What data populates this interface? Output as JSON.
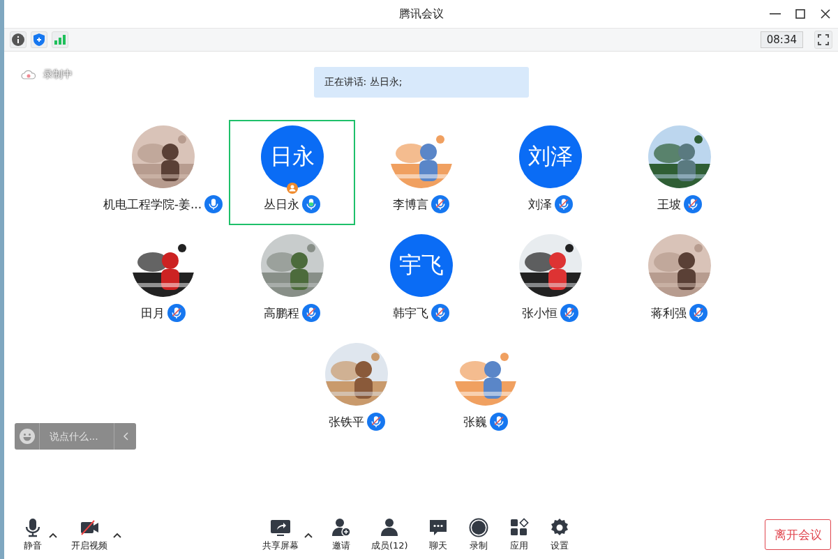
{
  "window": {
    "title": "腾讯会议"
  },
  "info_bar": {
    "time": "08:34"
  },
  "recording_indicator": {
    "label": "录制中"
  },
  "speaking_banner": {
    "text": "正在讲话: 丛日永;"
  },
  "participants": [
    {
      "name": "机电工程学院-姜...",
      "muted": false,
      "speaking": false,
      "host": false,
      "selected": false
    },
    {
      "name": "丛日永",
      "avatar": {
        "kind": "initials",
        "text": "日永"
      },
      "muted": false,
      "speaking": true,
      "host": true,
      "selected": true
    },
    {
      "name": "李博言",
      "muted": true,
      "speaking": false,
      "host": false,
      "selected": false
    },
    {
      "name": "刘泽",
      "avatar": {
        "kind": "initials",
        "text": "刘泽"
      },
      "muted": true,
      "speaking": false,
      "host": false,
      "selected": false
    },
    {
      "name": "王坡",
      "muted": true,
      "speaking": false,
      "host": false,
      "selected": false
    },
    {
      "name": "田月",
      "muted": true,
      "speaking": false,
      "host": false,
      "selected": false
    },
    {
      "name": "高鹏程",
      "muted": true,
      "speaking": false,
      "host": false,
      "selected": false
    },
    {
      "name": "韩宇飞",
      "avatar": {
        "kind": "initials",
        "text": "宇飞"
      },
      "muted": true,
      "speaking": false,
      "host": false,
      "selected": false
    },
    {
      "name": "张小恒",
      "muted": true,
      "speaking": false,
      "host": false,
      "selected": false
    },
    {
      "name": "蒋利强",
      "muted": true,
      "speaking": false,
      "host": false,
      "selected": false
    },
    {
      "name": "张铁平",
      "muted": true,
      "speaking": false,
      "host": false,
      "selected": false
    },
    {
      "name": "张巍",
      "muted": true,
      "speaking": false,
      "host": false,
      "selected": false
    }
  ],
  "chat_input": {
    "placeholder": "说点什么..."
  },
  "toolbar": {
    "left": [
      {
        "kind": "mute",
        "label": "静音",
        "caret": true
      },
      {
        "kind": "video",
        "label": "开启视频",
        "caret": true
      }
    ],
    "center": [
      {
        "kind": "share",
        "label": "共享屏幕",
        "caret": true
      },
      {
        "kind": "invite",
        "label": "邀请",
        "caret": false
      },
      {
        "kind": "members",
        "label": "成员(12)",
        "caret": false
      },
      {
        "kind": "chat",
        "label": "聊天",
        "caret": false
      },
      {
        "kind": "record",
        "label": "录制",
        "caret": false
      },
      {
        "kind": "apps",
        "label": "应用",
        "caret": false
      },
      {
        "kind": "settings",
        "label": "设置",
        "caret": false
      }
    ],
    "leave_button": "离开会议"
  }
}
